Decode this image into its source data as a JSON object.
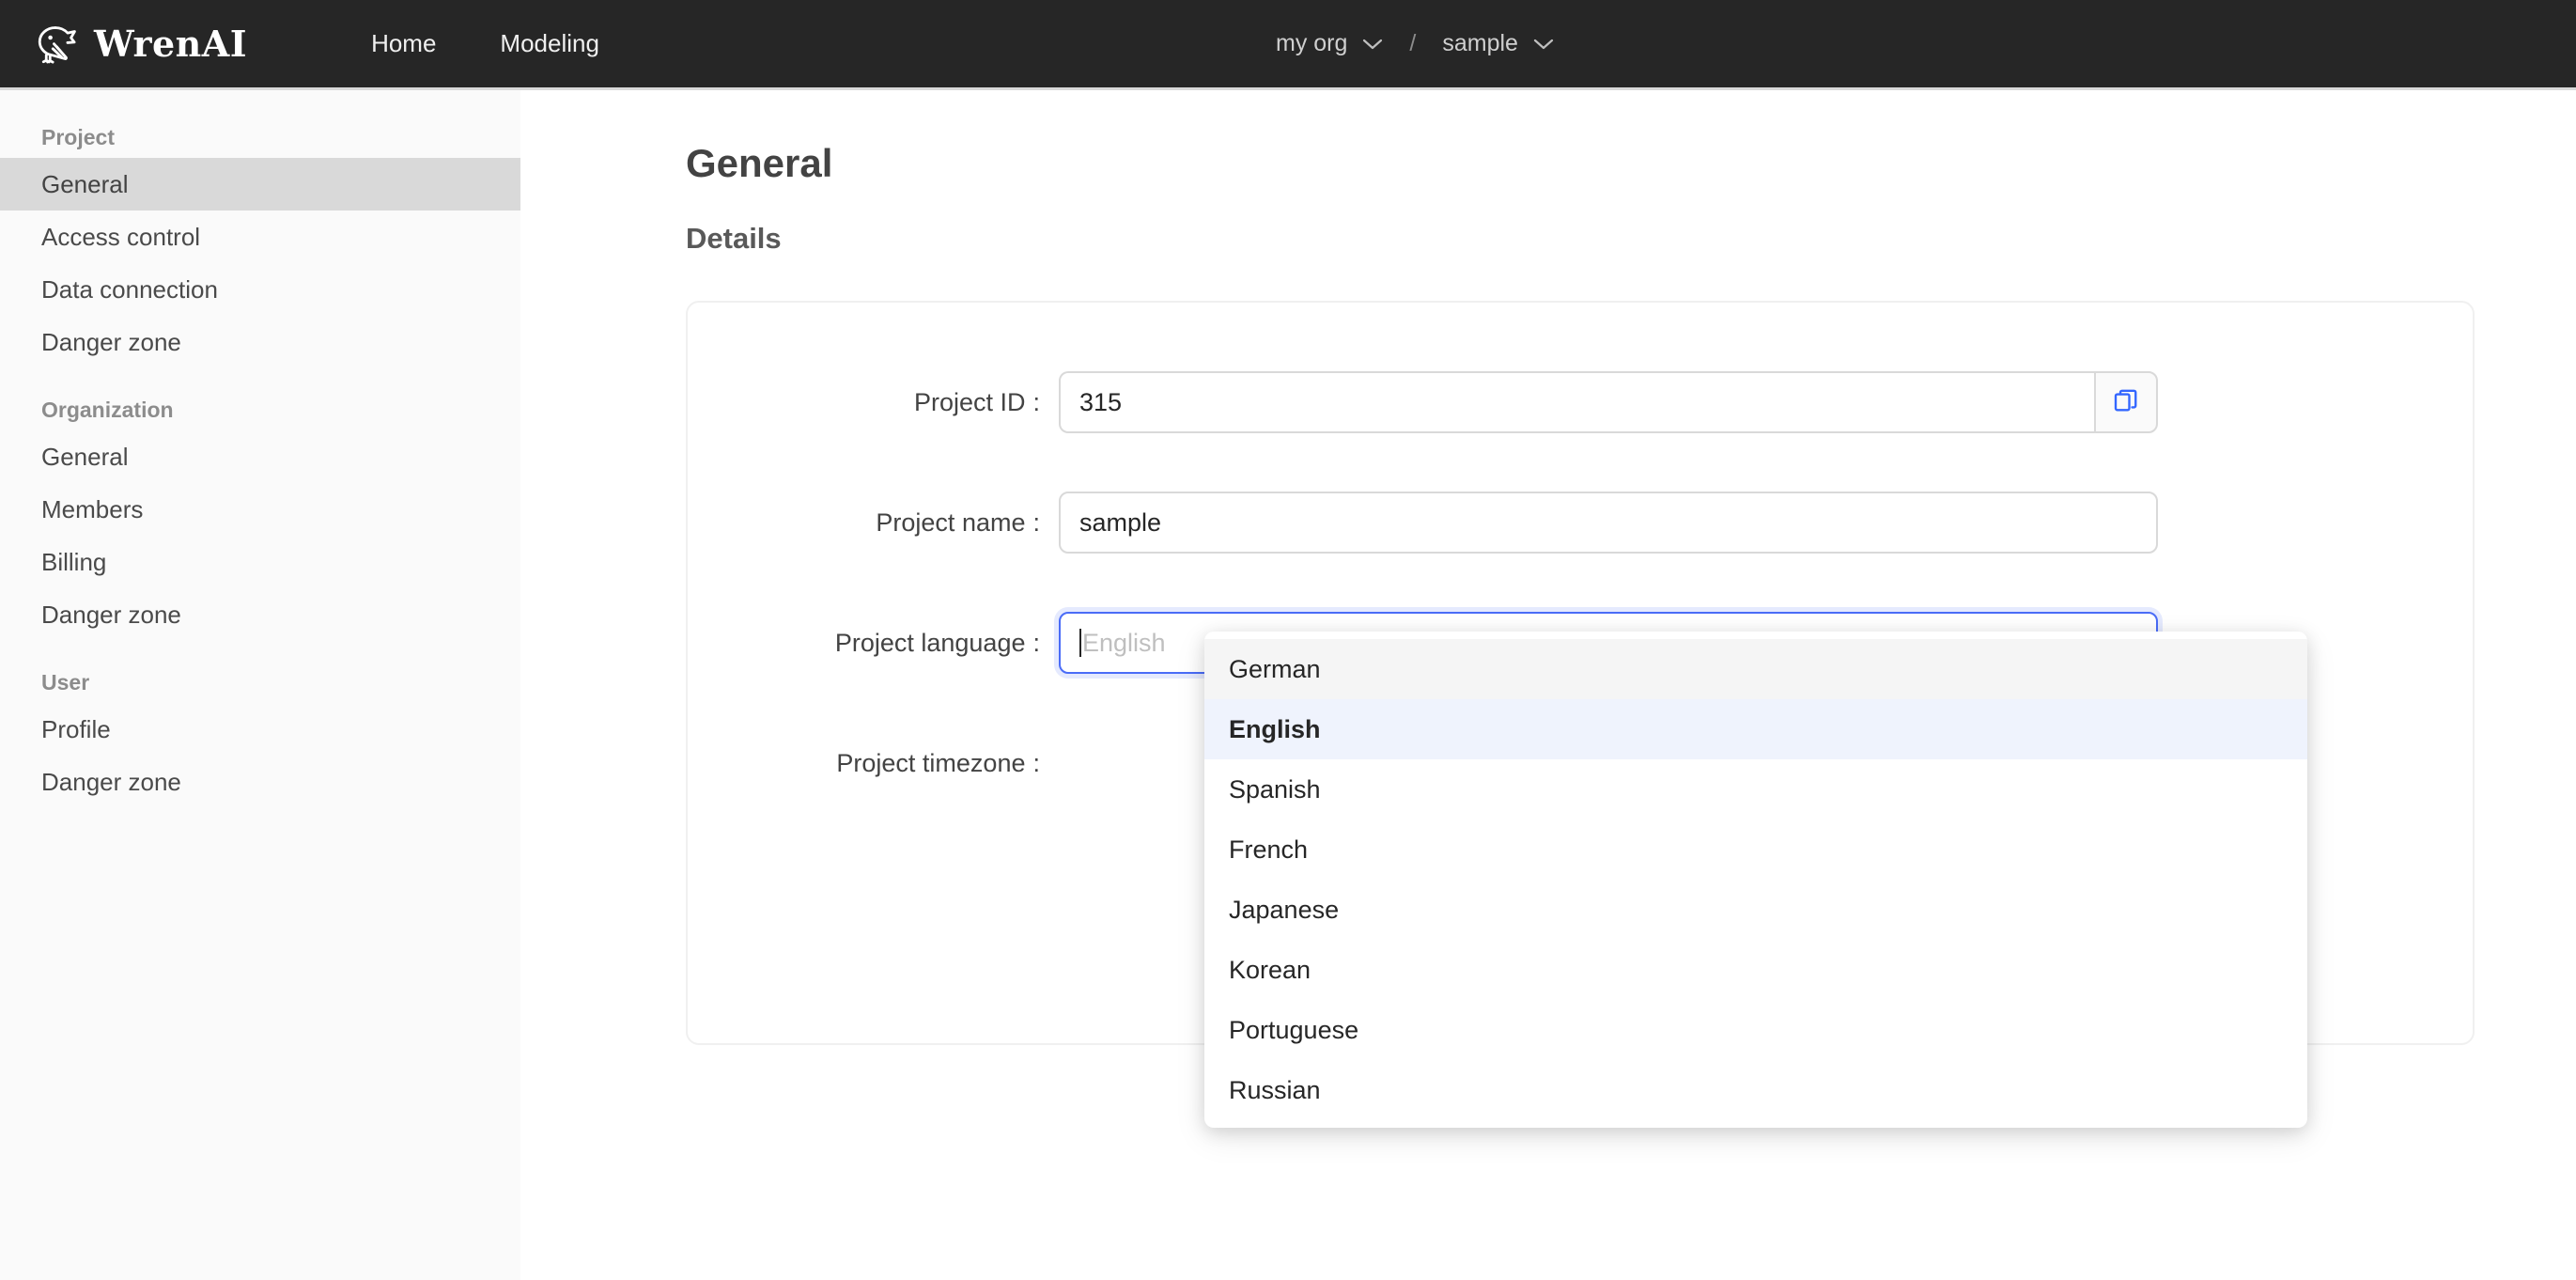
{
  "header": {
    "logo_icon": "wren-bird-logo-icon",
    "brand": "WrenAI",
    "nav": [
      {
        "label": "Home"
      },
      {
        "label": "Modeling"
      }
    ],
    "breadcrumb": {
      "org": "my org",
      "separator": "/",
      "project": "sample",
      "chevron_icon": "chevron-down-icon"
    }
  },
  "sidebar": {
    "groups": [
      {
        "title": "Project",
        "items": [
          {
            "label": "General",
            "active": true
          },
          {
            "label": "Access control",
            "active": false
          },
          {
            "label": "Data connection",
            "active": false
          },
          {
            "label": "Danger zone",
            "active": false
          }
        ]
      },
      {
        "title": "Organization",
        "items": [
          {
            "label": "General",
            "active": false
          },
          {
            "label": "Members",
            "active": false
          },
          {
            "label": "Billing",
            "active": false
          },
          {
            "label": "Danger zone",
            "active": false
          }
        ]
      },
      {
        "title": "User",
        "items": [
          {
            "label": "Profile",
            "active": false
          },
          {
            "label": "Danger zone",
            "active": false
          }
        ]
      }
    ]
  },
  "main": {
    "page_title": "General",
    "section_title": "Details",
    "form": {
      "project_id": {
        "label": "Project ID",
        "colon": ":",
        "value": "315",
        "copy_icon": "copy-icon",
        "copy_color": "#3366ff"
      },
      "project_name": {
        "label": "Project name",
        "colon": ":",
        "value": "sample"
      },
      "project_language": {
        "label": "Project language",
        "colon": ":",
        "value": "",
        "placeholder": "English",
        "search_icon": "search-icon",
        "focus_color": "#4a6cf7"
      },
      "project_timezone": {
        "label": "Project timezone",
        "colon": ":"
      }
    },
    "language_dropdown": {
      "options": [
        {
          "label": "German",
          "state": "hover"
        },
        {
          "label": "English",
          "state": "selected"
        },
        {
          "label": "Spanish",
          "state": "normal"
        },
        {
          "label": "French",
          "state": "normal"
        },
        {
          "label": "Japanese",
          "state": "normal"
        },
        {
          "label": "Korean",
          "state": "normal"
        },
        {
          "label": "Portuguese",
          "state": "normal"
        },
        {
          "label": "Russian",
          "state": "normal"
        }
      ]
    }
  }
}
